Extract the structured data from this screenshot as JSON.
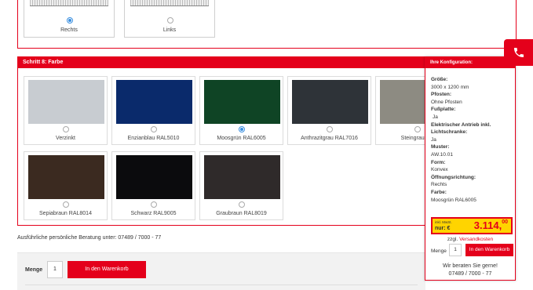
{
  "direction": {
    "options": [
      {
        "label": "Rechts",
        "checked": true
      },
      {
        "label": "Links",
        "checked": false
      }
    ]
  },
  "step8": {
    "title": "Schritt 8:  Farbe",
    "colors": [
      {
        "label": "Verzinkt",
        "swatch": "#c8ccd1",
        "checked": false
      },
      {
        "label": "Enzianblau RAL5010",
        "swatch": "#0a2a6b",
        "checked": false
      },
      {
        "label": "Moosgrün RAL6005",
        "swatch": "#0f4425",
        "checked": true
      },
      {
        "label": "Anthrazitgrau RAL7016",
        "swatch": "#2e3338",
        "checked": false
      },
      {
        "label": "Steingrau RA",
        "swatch": "#8d8b82",
        "checked": false
      },
      {
        "label": "Sepiabraun RAL8014",
        "swatch": "#3b2a20",
        "checked": false
      },
      {
        "label": "Schwarz RAL9005",
        "swatch": "#0b0b0d",
        "checked": false
      },
      {
        "label": "Graubraun RAL8019",
        "swatch": "#2f2a2a",
        "checked": false
      }
    ]
  },
  "contact": {
    "text": "Ausführliche persönliche Beratung unter: 07489 / 7000 - 77"
  },
  "cart": {
    "menge_label": "Menge",
    "quantity": "1",
    "button_label": "In den Warenkorb"
  },
  "config": {
    "title": "Ihre Konfiguration:",
    "items": [
      {
        "key": "Größe:",
        "value": "3000 x 1200 mm"
      },
      {
        "key": "Pfosten:",
        "value": "Ohne Pfosten"
      },
      {
        "key": "Fußplatte:",
        "value": "Ja"
      },
      {
        "key": "Elektrischer Antrieb inkl. Lichtschranke:",
        "value": "Ja"
      },
      {
        "key": "Muster:",
        "value": "AW.10.01"
      },
      {
        "key": "Form:",
        "value": "Konvex"
      },
      {
        "key": "Öffnungsrichtung:",
        "value": "Rechts"
      },
      {
        "key": "Farbe:",
        "value": "Moosgrün RAL6005"
      }
    ],
    "price_note": "inkl. MwSt.",
    "price_prefix": "nur: €",
    "price_main": "3.114,",
    "price_cents": "00",
    "shipping_prefix": "zzgl.",
    "shipping_link": "Versandkosten",
    "menge_label": "Menge",
    "quantity": "1",
    "button_label": "In den Warenkorb",
    "advice_line1": "Wir beraten Sie gerne!",
    "advice_line2": "07489 / 7000 - 77"
  },
  "colors": {
    "accent": "#e4001b",
    "price_bg": "#ffd400",
    "radio_selected": "#3a8fe0"
  }
}
